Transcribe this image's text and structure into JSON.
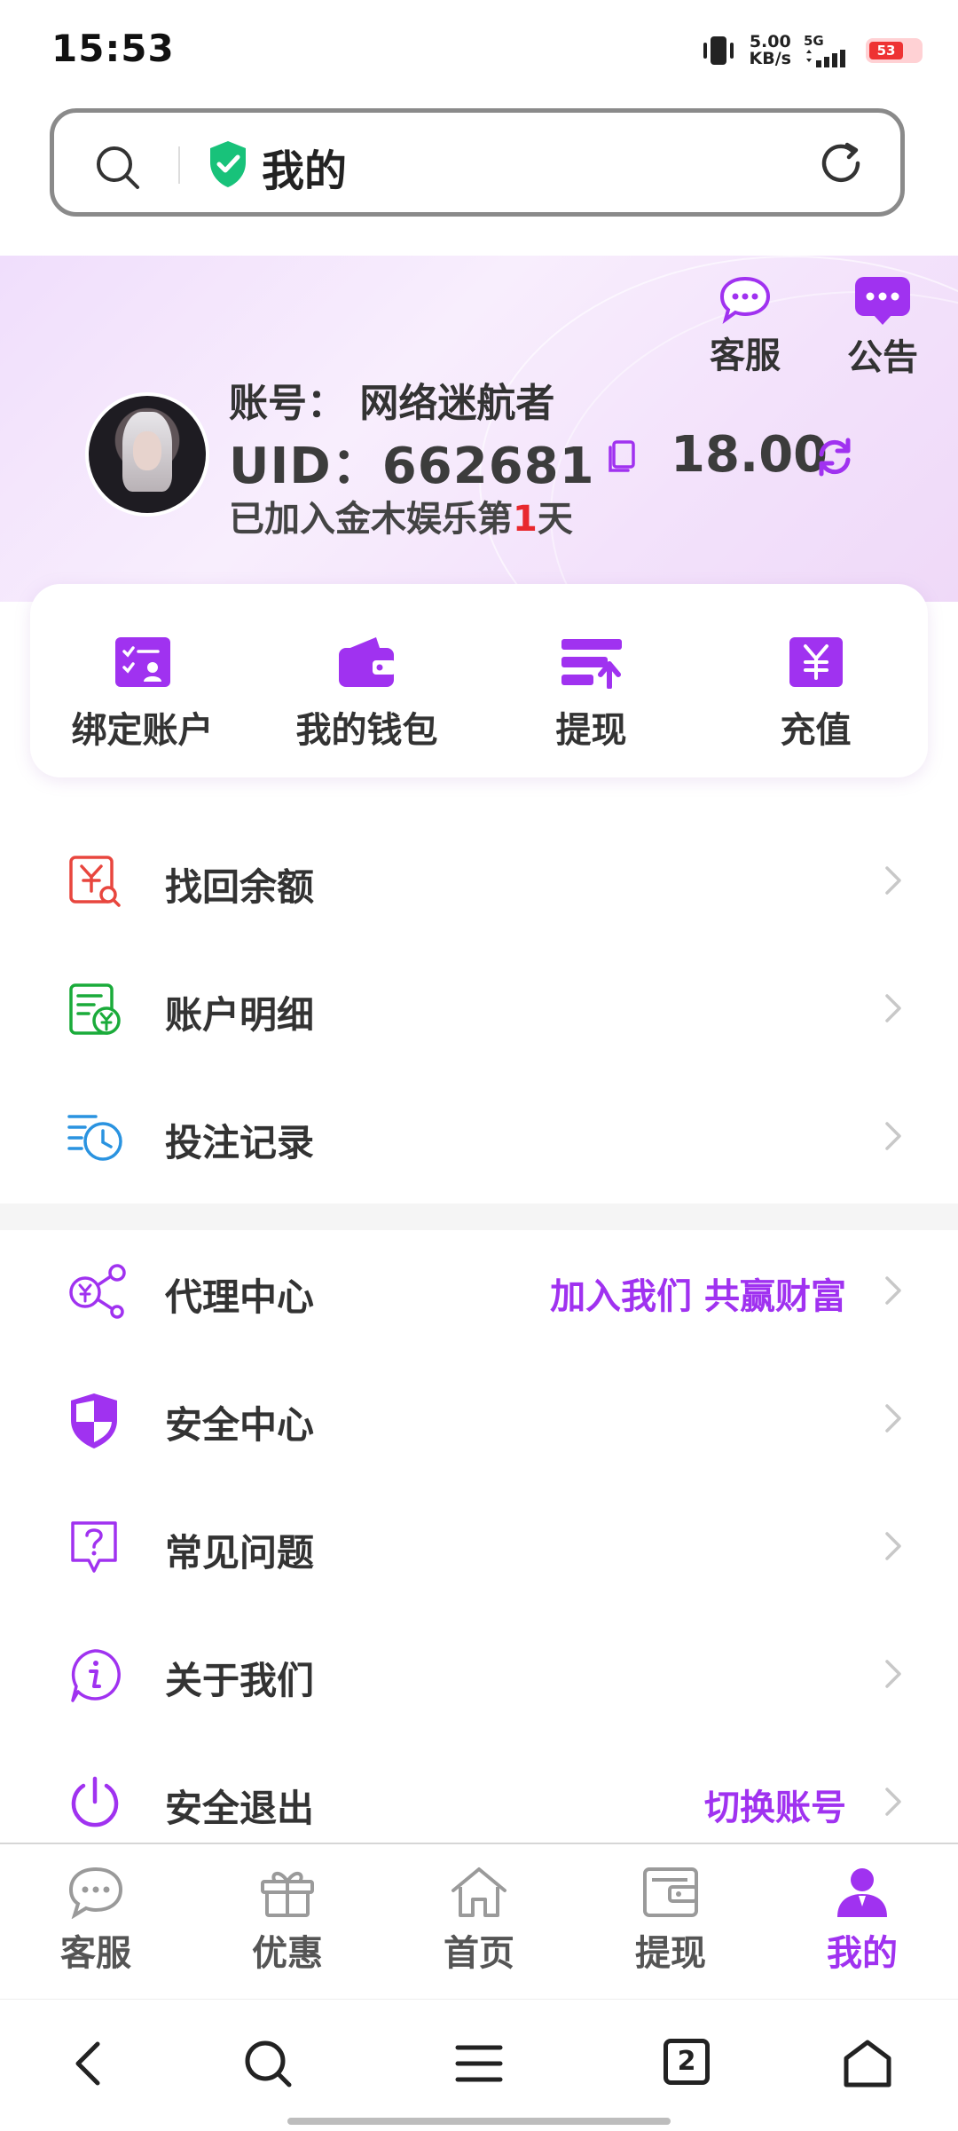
{
  "status_bar": {
    "time": "15:53",
    "net_speed_value": "5.00",
    "net_speed_unit": "KB/s",
    "network_type": "5G",
    "battery": "53"
  },
  "browser": {
    "title": "我的"
  },
  "header": {
    "customer_service": "客服",
    "announcement": "公告",
    "account_label": "账号：",
    "account_name": "网络迷航者",
    "uid_label": "UID：",
    "uid": "662681",
    "balance": "18.00",
    "joined_prefix": "已加入金木娱乐第",
    "joined_days": "1",
    "joined_suffix": "天"
  },
  "quick_actions": [
    {
      "label": "绑定账户",
      "icon": "bind-account-icon"
    },
    {
      "label": "我的钱包",
      "icon": "wallet-icon"
    },
    {
      "label": "提现",
      "icon": "withdraw-icon"
    },
    {
      "label": "充值",
      "icon": "recharge-icon"
    }
  ],
  "menu_group_1": [
    {
      "label": "找回余额",
      "icon": "recover-balance-icon",
      "color": "#e8463e"
    },
    {
      "label": "账户明细",
      "icon": "account-details-icon",
      "color": "#1aab3a"
    },
    {
      "label": "投注记录",
      "icon": "bet-history-icon",
      "color": "#2a93e0"
    }
  ],
  "menu_group_2": [
    {
      "label": "代理中心",
      "extra": "加入我们 共赢财富",
      "icon": "agent-center-icon"
    },
    {
      "label": "安全中心",
      "extra": "",
      "icon": "security-center-icon"
    },
    {
      "label": "常见问题",
      "extra": "",
      "icon": "faq-icon"
    },
    {
      "label": "关于我们",
      "extra": "",
      "icon": "about-icon"
    },
    {
      "label": "安全退出",
      "extra": "切换账号",
      "icon": "logout-icon"
    }
  ],
  "tab_bar": [
    {
      "label": "客服",
      "icon": "chat-icon",
      "active": false
    },
    {
      "label": "优惠",
      "icon": "gift-icon",
      "active": false
    },
    {
      "label": "首页",
      "icon": "home-icon",
      "active": false
    },
    {
      "label": "提现",
      "icon": "wallet-icon",
      "active": false
    },
    {
      "label": "我的",
      "icon": "user-icon",
      "active": true
    }
  ],
  "browser_nav": {
    "tab_count": "2"
  },
  "colors": {
    "accent": "#a032f0",
    "red": "#e8282e",
    "green": "#1aab3a",
    "blue": "#2a93e0"
  }
}
